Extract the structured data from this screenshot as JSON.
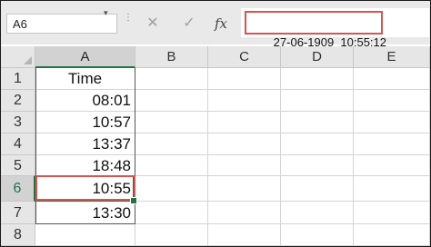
{
  "name_box": {
    "value": "A6"
  },
  "formula_bar": {
    "cancel_icon": "close-icon",
    "enter_icon": "check-icon",
    "function_label": "fx",
    "value": "27-06-1909  10:55:12"
  },
  "columns": [
    "A",
    "B",
    "C",
    "D",
    "E"
  ],
  "selected_column": "A",
  "rows": [
    "1",
    "2",
    "3",
    "4",
    "5",
    "6",
    "7",
    "8"
  ],
  "selected_row": "6",
  "cells": {
    "A1": "Time",
    "A2": "08:01",
    "A3": "10:57",
    "A4": "13:37",
    "A5": "18:48",
    "A6": "10:55",
    "A7": "13:30"
  },
  "colors": {
    "selection": "#217346",
    "highlight": "#d9534f"
  }
}
